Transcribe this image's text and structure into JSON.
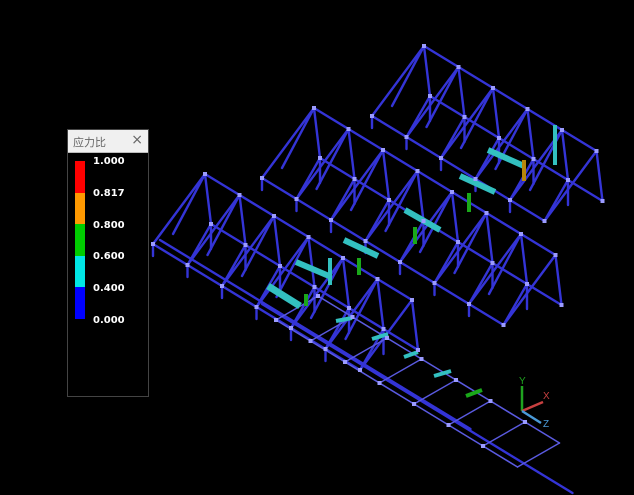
{
  "legend": {
    "title": "应力比",
    "close_glyph": "×",
    "stops": [
      "1.000",
      "0.817",
      "0.800",
      "0.600",
      "0.400",
      "0.000"
    ],
    "colors": [
      "#ff0000",
      "#ff9900",
      "#00cc00",
      "#00e6e6",
      "#0000ff"
    ]
  },
  "axes": {
    "x_label": "X",
    "y_label": "Y",
    "z_label": "Z"
  },
  "colors": {
    "background": "#000000",
    "frame_members": "#2f2fd8",
    "node": "#9a9aff",
    "high_ratio": "#b8860b",
    "mid_ratio": "#1aa81a",
    "low_ratio": "#3cc8c8"
  }
}
